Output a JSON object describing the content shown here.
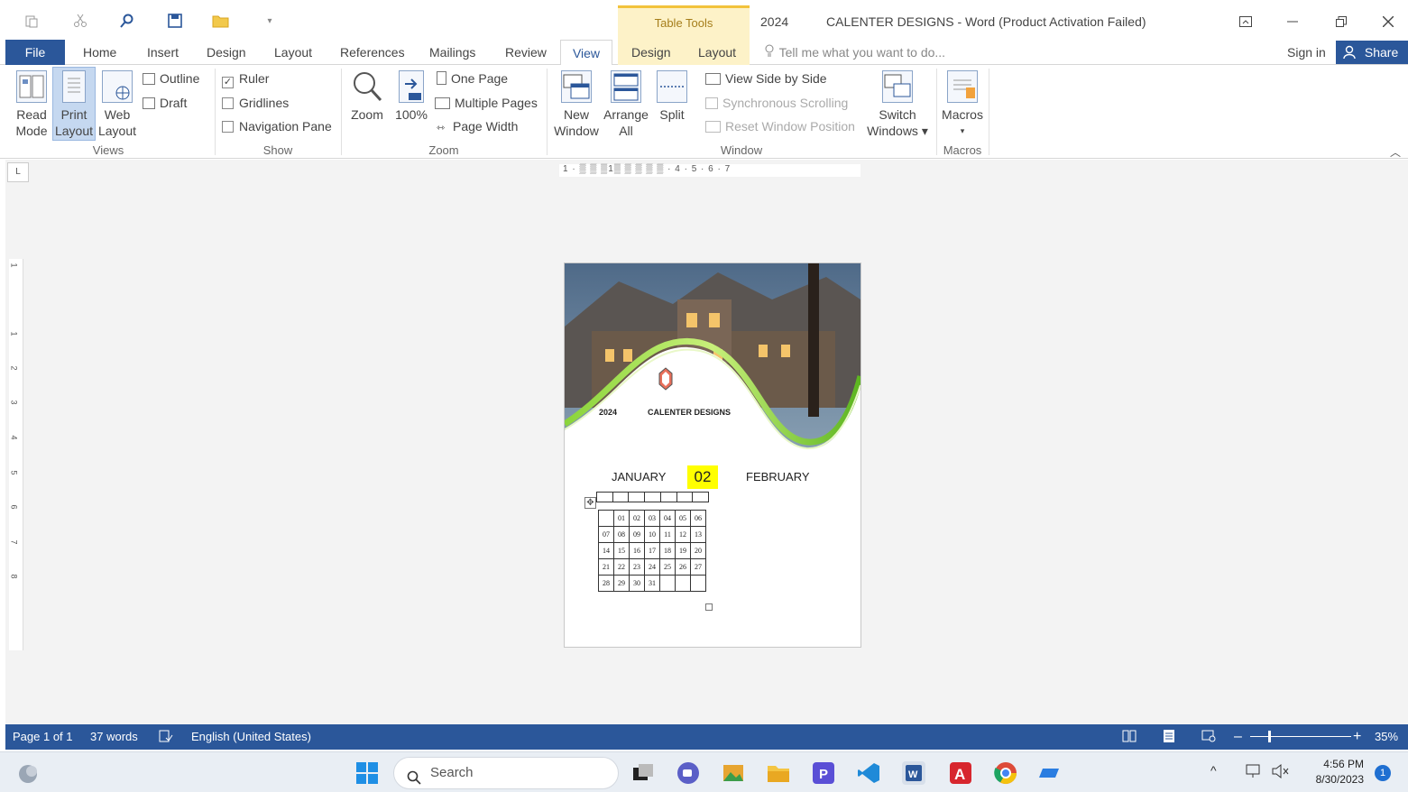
{
  "titlebar": {
    "context_tab_group": "Table Tools",
    "doc_short": "2024",
    "window_title": "CALENTER DESIGNS - Word (Product Activation Failed)",
    "qat_icons": [
      "paste-icon",
      "cut-icon",
      "find-icon",
      "save-icon",
      "open-folder-icon",
      "customize-qat-icon"
    ]
  },
  "tabs": {
    "file": "File",
    "home": "Home",
    "insert": "Insert",
    "design": "Design",
    "layout": "Layout",
    "references": "References",
    "mailings": "Mailings",
    "review": "Review",
    "view": "View",
    "table_design": "Design",
    "table_layout": "Layout",
    "tell_me": "Tell me what you want to do...",
    "sign_in": "Sign in",
    "share": "Share"
  },
  "ribbon": {
    "views": {
      "label": "Views",
      "read_mode": [
        "Read",
        "Mode"
      ],
      "print_layout": [
        "Print",
        "Layout"
      ],
      "web_layout": [
        "Web",
        "Layout"
      ],
      "outline": "Outline",
      "draft": "Draft"
    },
    "show": {
      "label": "Show",
      "ruler": "Ruler",
      "ruler_checked": true,
      "gridlines": "Gridlines",
      "navigation_pane": "Navigation Pane"
    },
    "zoom": {
      "label": "Zoom",
      "zoom": "Zoom",
      "hundred": "100%",
      "one_page": "One Page",
      "multiple_pages": "Multiple Pages",
      "page_width": "Page Width"
    },
    "window": {
      "label": "Window",
      "new_window": [
        "New",
        "Window"
      ],
      "arrange_all": [
        "Arrange",
        "All"
      ],
      "split": "Split",
      "view_side_by_side": "View Side by Side",
      "synchronous_scrolling": "Synchronous Scrolling",
      "reset_window_position": "Reset Window Position",
      "switch_windows": [
        "Switch",
        "Windows ▾"
      ]
    },
    "macros": {
      "label": "Macros",
      "macros": "Macros"
    }
  },
  "ruler": {
    "corner": "L",
    "h_ticks": "1 · ▒ ▒ ▒1▒ ▒ ▒ ▒ ▒ · 4 · 5 · 6 · 7",
    "v_ticks": [
      "1",
      "1",
      "2",
      "3",
      "4",
      "5",
      "6",
      "7",
      "8"
    ]
  },
  "document": {
    "year": "2024",
    "title": "CALENTER DESIGNS",
    "month_left": "JANUARY",
    "month_number": "02",
    "month_right": "FEBRUARY",
    "calendar_rows": [
      [
        "",
        "01",
        "02",
        "03",
        "04",
        "05",
        "06"
      ],
      [
        "07",
        "08",
        "09",
        "10",
        "11",
        "12",
        "13"
      ],
      [
        "14",
        "15",
        "16",
        "17",
        "18",
        "19",
        "20"
      ],
      [
        "21",
        "22",
        "23",
        "24",
        "25",
        "26",
        "27"
      ],
      [
        "28",
        "29",
        "30",
        "31",
        "",
        "",
        ""
      ]
    ]
  },
  "statusbar": {
    "page": "Page 1 of 1",
    "words": "37 words",
    "language": "English (United States)",
    "zoom_level": "35%",
    "zoom_fraction": 0.18
  },
  "taskbar": {
    "search": "Search",
    "time": "4:56 PM",
    "date": "8/30/2023",
    "notification_count": "1",
    "apps": [
      "windows-start-icon",
      "task-view-icon",
      "teams-icon",
      "photos-icon",
      "file-explorer-icon",
      "publisher-icon",
      "vscode-icon",
      "word-icon",
      "acrobat-icon",
      "chrome-icon",
      "remote-icon"
    ]
  },
  "colors": {
    "word_blue": "#2b579a",
    "table_tools": "#fdf2c8",
    "highlight": "#ffff00"
  }
}
